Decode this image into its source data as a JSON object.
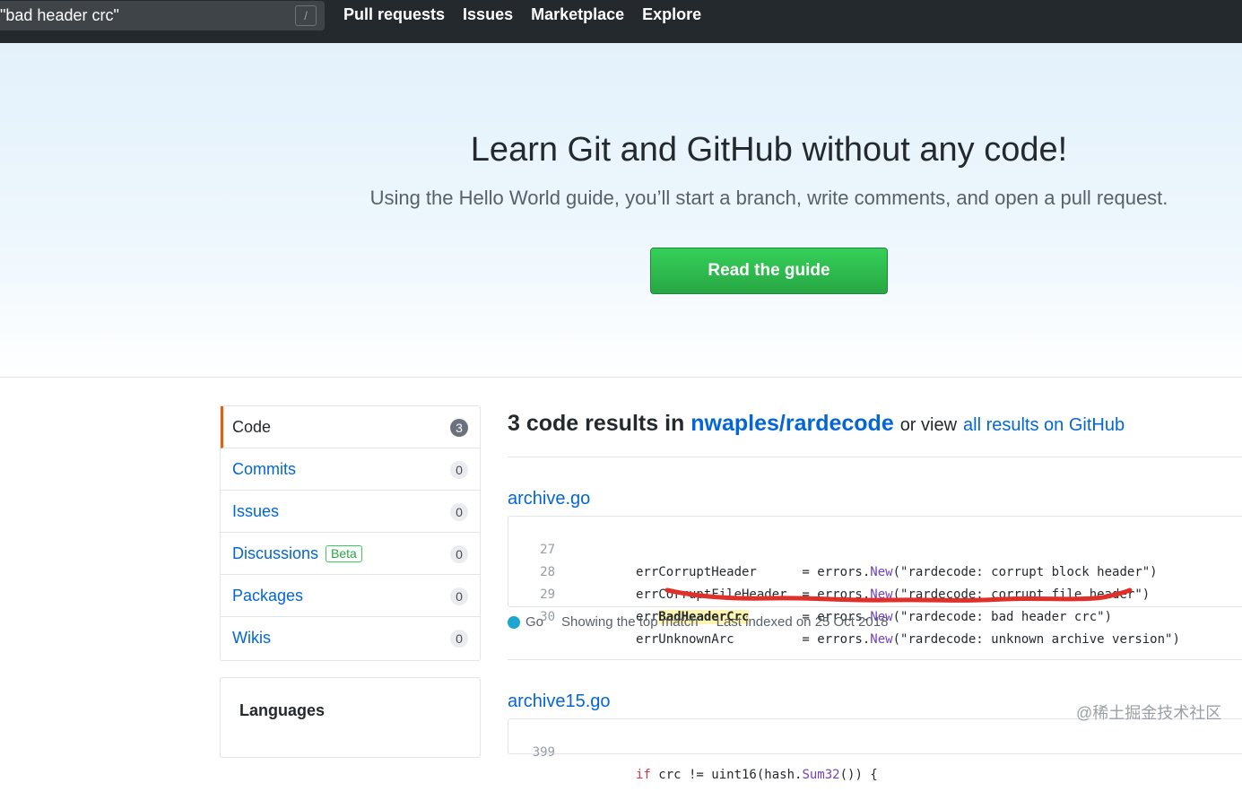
{
  "header": {
    "search_value": "\"bad header crc\"",
    "slash_key": "/",
    "nav": [
      "Pull requests",
      "Issues",
      "Marketplace",
      "Explore"
    ]
  },
  "hero": {
    "title": "Learn Git and GitHub without any code!",
    "subtitle": "Using the Hello World guide, you’ll start a branch, write comments, and open a pull request.",
    "button": "Read the guide"
  },
  "menu": {
    "items": [
      {
        "label": "Code",
        "count": "3"
      },
      {
        "label": "Commits",
        "count": "0"
      },
      {
        "label": "Issues",
        "count": "0"
      },
      {
        "label": "Discussions",
        "count": "0",
        "badge": "Beta"
      },
      {
        "label": "Packages",
        "count": "0"
      },
      {
        "label": "Wikis",
        "count": "0"
      }
    ]
  },
  "languages": {
    "title": "Languages"
  },
  "results": {
    "count_text": "3 code results in",
    "repo": "nwaples/rardecode",
    "or_view": "or view",
    "all_results": "all results on GitHub"
  },
  "files": [
    {
      "name": "archive.go",
      "lines": [
        {
          "num": "27",
          "pre": "errCorruptHeader      = errors.",
          "fn": "New",
          "post": "(\"rardecode: corrupt block header\")"
        },
        {
          "num": "28",
          "pre": "errCorruptFileHeader  = errors.",
          "fn": "New",
          "post": "(\"rardecode: corrupt file header\")"
        },
        {
          "num": "29",
          "pre": "err",
          "hl": "BadHeaderCrc",
          "mid": "       = errors.",
          "fn": "New",
          "post": "(\"rardecode: bad header crc\")"
        },
        {
          "num": "30",
          "pre": "errUnknownArc         = errors.",
          "fn": "New",
          "post": "(\"rardecode: unknown archive version\")"
        }
      ],
      "language": "Go",
      "match_note": "Showing the top match",
      "indexed": "Last indexed on 25 Oct 2018"
    },
    {
      "name": "archive15.go",
      "lines": [
        {
          "num": "399",
          "kw": "if",
          "pre": " crc != uint16(hash.",
          "fn": "Sum32",
          "post": "()) {"
        }
      ]
    }
  ],
  "watermark": "@稀土掘金技术社区",
  "colors": {
    "topbar": "#24292e",
    "link": "#0366d6",
    "button": "#28a745",
    "selected_border": "#e36209",
    "annotation_red": "#e0302a"
  }
}
